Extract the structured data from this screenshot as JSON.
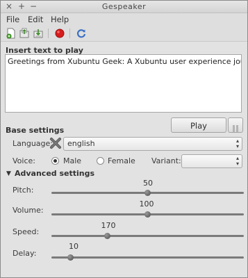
{
  "window": {
    "title": "Gespeaker",
    "buttons": [
      "×",
      "+",
      "−"
    ]
  },
  "menubar": {
    "items": [
      "File",
      "Edit",
      "Help"
    ]
  },
  "toolbar": {
    "icons": [
      "new-document-icon",
      "open-file-icon",
      "save-file-icon",
      "record-icon",
      "refresh-icon"
    ],
    "record_color": "#d61c1c",
    "accent_color": "#3a6fc4"
  },
  "insert": {
    "label": "Insert text to play",
    "text": "Greetings from Xubuntu Geek: A Xubuntu user experience journal!"
  },
  "controls": {
    "play_label": "Play"
  },
  "base_settings": {
    "label": "Base settings",
    "language_label": "Language:",
    "language_value": "english",
    "voice_label": "Voice:",
    "male_label": "Male",
    "female_label": "Female",
    "voice_selected": "Male",
    "variant_label": "Variant:",
    "variant_value": ""
  },
  "advanced_settings": {
    "label": "Advanced settings",
    "expanded": true,
    "sliders": [
      {
        "label": "Pitch:",
        "value": "50",
        "fraction": 0.5
      },
      {
        "label": "Volume:",
        "value": "100",
        "fraction": 0.5
      },
      {
        "label": "Speed:",
        "value": "170",
        "fraction": 0.29
      },
      {
        "label": "Delay:",
        "value": "10",
        "fraction": 0.1
      }
    ]
  }
}
